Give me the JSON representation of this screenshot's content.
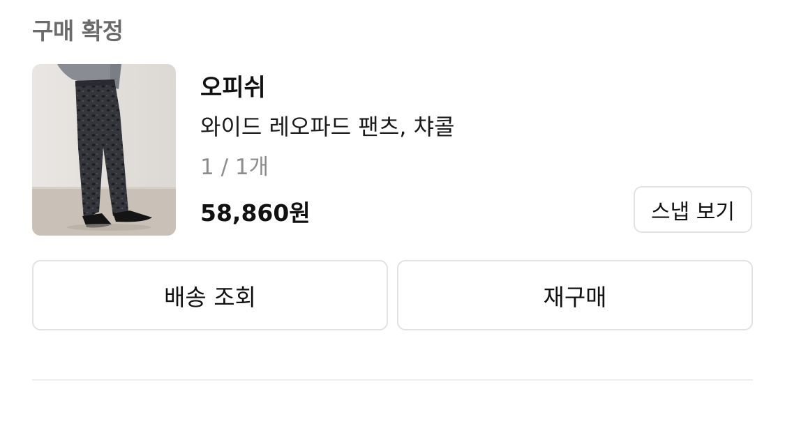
{
  "order": {
    "status": "구매 확정",
    "brand": "오피쉬",
    "product_name": "와이드 레오파드 팬츠, 챠콜",
    "quantity": "1 / 1개",
    "price": "58,860원",
    "snap_button": "스냅 보기",
    "tracking_button": "배송 조회",
    "reorder_button": "재구매"
  },
  "colors": {
    "status_text": "#6b6b6b",
    "quantity_text": "#8c8c8c",
    "border": "#e2e2e2"
  },
  "icons": {
    "thumbnail": "product-photo-pants"
  }
}
